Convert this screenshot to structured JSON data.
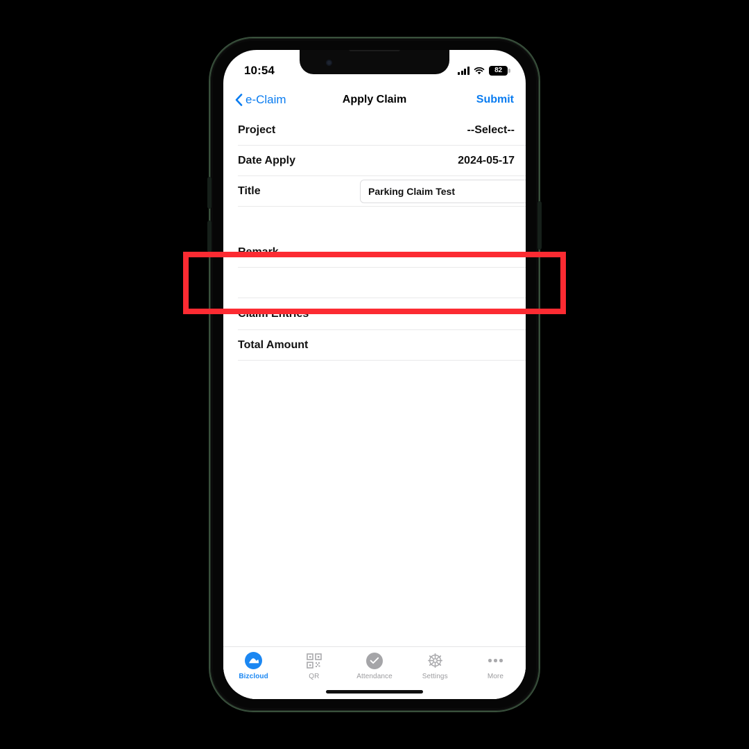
{
  "device": {
    "status_bar": {
      "time": "10:54",
      "signal_icon": "cellular-signal-icon",
      "wifi_icon": "wifi-icon",
      "battery_level": "82"
    },
    "home_indicator": "home-indicator"
  },
  "nav": {
    "back_label": "e-Claim",
    "back_icon": "chevron-left-icon",
    "title": "Apply Claim",
    "submit_label": "Submit",
    "accent_color": "#0a7cf0"
  },
  "form": {
    "rows": [
      {
        "label": "Project",
        "value": "--Select--",
        "type": "select"
      },
      {
        "label": "Date Apply",
        "value": "2024-05-17",
        "type": "date"
      },
      {
        "label": "Title",
        "value": "Parking Claim Test",
        "type": "text-input"
      },
      {
        "label": "Remark",
        "value": "",
        "type": "text"
      },
      {
        "label": "Claim Entries",
        "value": "",
        "type": "section"
      },
      {
        "label": "Total Amount",
        "value": "",
        "type": "text"
      }
    ]
  },
  "tab_bar": {
    "items": [
      {
        "label": "Bizcloud",
        "icon": "cloud-icon",
        "active": true
      },
      {
        "label": "QR",
        "icon": "qr-code-icon",
        "active": false
      },
      {
        "label": "Attendance",
        "icon": "check-circle-icon",
        "active": false
      },
      {
        "label": "Settings",
        "icon": "gear-icon",
        "active": false
      },
      {
        "label": "More",
        "icon": "ellipsis-icon",
        "active": false
      }
    ],
    "active_color": "#1b87f2",
    "inactive_color": "#9b9b9e"
  },
  "annotation": {
    "name": "claim-entries-highlight",
    "color": "#fc2b32",
    "target": "Claim Entries"
  }
}
